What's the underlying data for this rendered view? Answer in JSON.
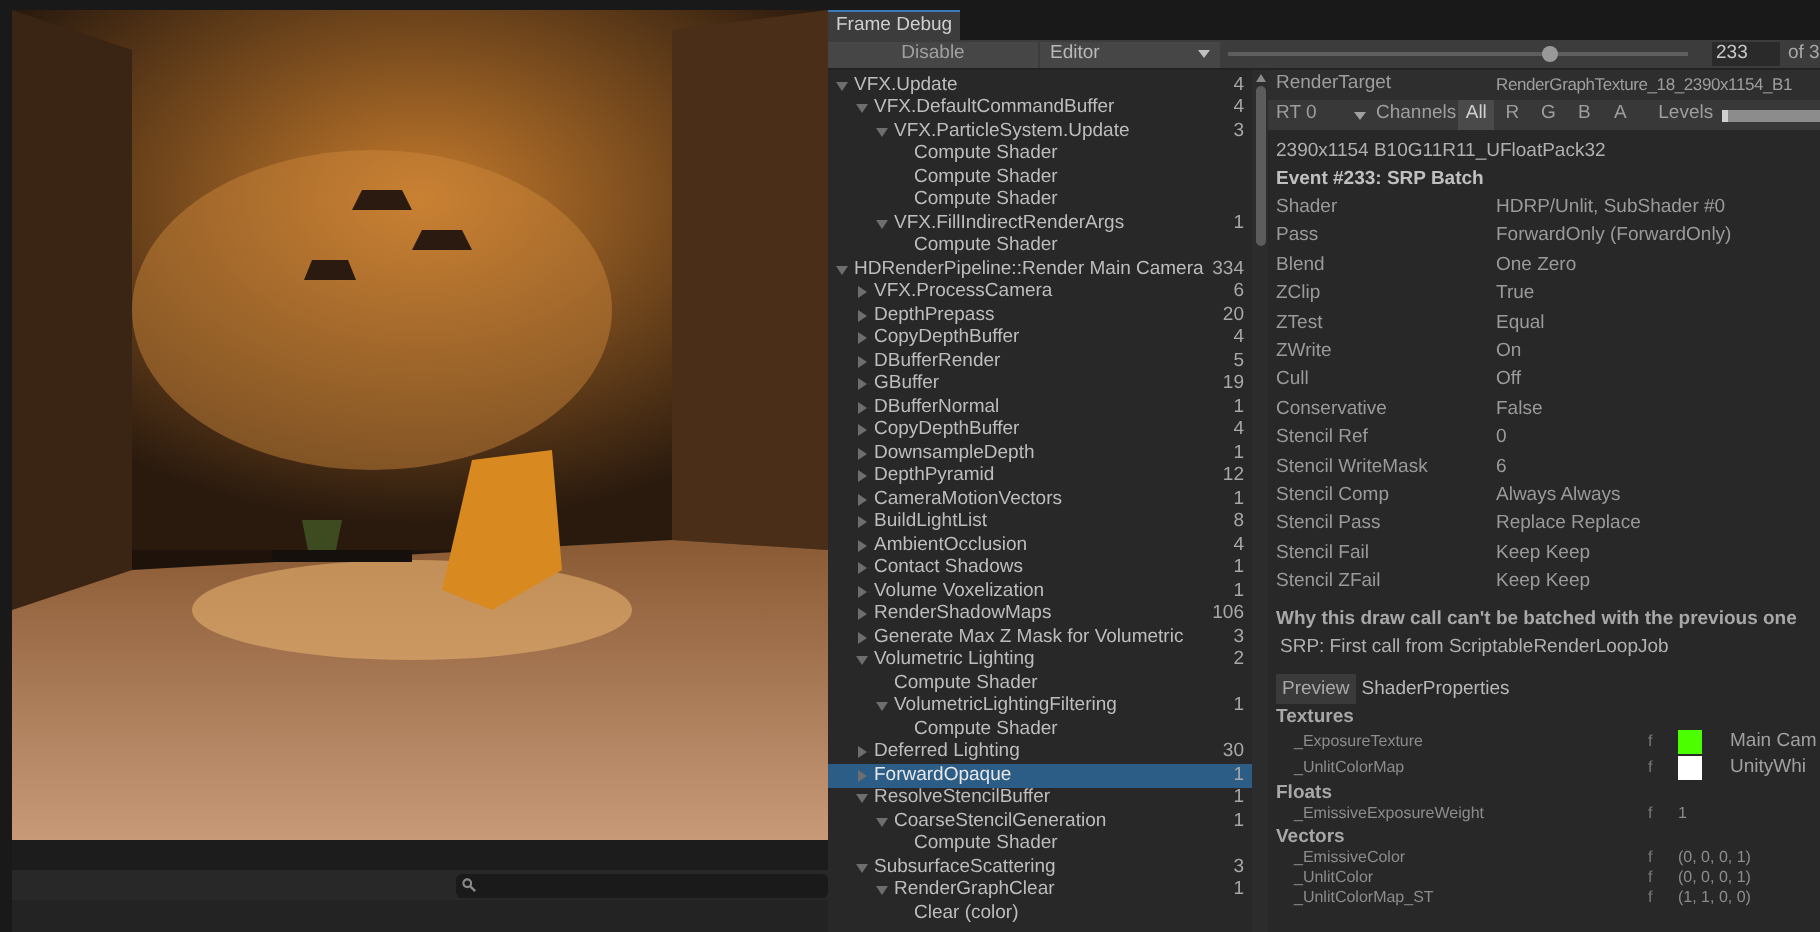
{
  "window_tab": {
    "title": "Frame Debug",
    "selected": true
  },
  "toolbar": {
    "disable_button": "Disable",
    "mode_dropdown": "Editor",
    "event_slider": {
      "level": 0.7
    },
    "event_number": "233",
    "event_total": "of 3"
  },
  "tree": [
    {
      "label": "VFX.Update",
      "count": "4",
      "expanded": true,
      "selected": false,
      "children": [
        {
          "label": "VFX.DefaultCommandBuffer",
          "count": "4",
          "expanded": true,
          "selected": false,
          "children": [
            {
              "label": "VFX.ParticleSystem.Update",
              "count": "3",
              "expanded": true,
              "selected": false,
              "children": [
                {
                  "label": "Compute Shader",
                  "selected": false
                },
                {
                  "label": "Compute Shader",
                  "selected": false
                },
                {
                  "label": "Compute Shader",
                  "selected": false
                }
              ]
            },
            {
              "label": "VFX.FillIndirectRenderArgs",
              "count": "1",
              "expanded": true,
              "selected": false,
              "children": [
                {
                  "label": "Compute Shader",
                  "selected": false
                }
              ]
            }
          ]
        }
      ]
    },
    {
      "label": "HDRenderPipeline::Render Main Camera",
      "count": "334",
      "expanded": true,
      "selected": false,
      "children": [
        {
          "label": "VFX.ProcessCamera",
          "count": "6",
          "expanded": false,
          "selected": false
        },
        {
          "label": "DepthPrepass",
          "count": "20",
          "expanded": false,
          "selected": false
        },
        {
          "label": "CopyDepthBuffer",
          "count": "4",
          "expanded": false,
          "selected": false
        },
        {
          "label": "DBufferRender",
          "count": "5",
          "expanded": false,
          "selected": false
        },
        {
          "label": "GBuffer",
          "count": "19",
          "expanded": false,
          "selected": false
        },
        {
          "label": "DBufferNormal",
          "count": "1",
          "expanded": false,
          "selected": false
        },
        {
          "label": "CopyDepthBuffer",
          "count": "4",
          "expanded": false,
          "selected": false
        },
        {
          "label": "DownsampleDepth",
          "count": "1",
          "expanded": false,
          "selected": false
        },
        {
          "label": "DepthPyramid",
          "count": "12",
          "expanded": false,
          "selected": false
        },
        {
          "label": "CameraMotionVectors",
          "count": "1",
          "expanded": false,
          "selected": false
        },
        {
          "label": "BuildLightList",
          "count": "8",
          "expanded": false,
          "selected": false
        },
        {
          "label": "AmbientOcclusion",
          "count": "4",
          "expanded": false,
          "selected": false
        },
        {
          "label": "Contact Shadows",
          "count": "1",
          "expanded": false,
          "selected": false
        },
        {
          "label": "Volume Voxelization",
          "count": "1",
          "expanded": false,
          "selected": false
        },
        {
          "label": "RenderShadowMaps",
          "count": "106",
          "expanded": false,
          "selected": false
        },
        {
          "label": "Generate Max Z Mask for Volumetric",
          "count": "3",
          "expanded": false,
          "selected": false
        },
        {
          "label": "Volumetric Lighting",
          "count": "2",
          "expanded": true,
          "selected": false,
          "children": [
            {
              "label": "Compute Shader",
              "selected": false
            },
            {
              "label": "VolumetricLightingFiltering",
              "count": "1",
              "expanded": true,
              "selected": false,
              "children": [
                {
                  "label": "Compute Shader",
                  "selected": false
                }
              ]
            }
          ]
        },
        {
          "label": "Deferred Lighting",
          "count": "30",
          "expanded": false,
          "selected": false
        },
        {
          "label": "ForwardOpaque",
          "count": "1",
          "expanded": false,
          "selected": true
        },
        {
          "label": "ResolveStencilBuffer",
          "count": "1",
          "expanded": true,
          "selected": false,
          "children": [
            {
              "label": "CoarseStencilGeneration",
              "count": "1",
              "expanded": true,
              "selected": false,
              "children": [
                {
                  "label": "Compute Shader",
                  "selected": false
                }
              ]
            }
          ]
        },
        {
          "label": "SubsurfaceScattering",
          "count": "3",
          "expanded": true,
          "selected": false,
          "children": [
            {
              "label": "RenderGraphClear",
              "count": "1",
              "expanded": true,
              "selected": false,
              "children": [
                {
                  "label": "Clear (color)",
                  "selected": false
                }
              ]
            }
          ]
        }
      ]
    }
  ],
  "details": {
    "render_target": {
      "label": "RenderTarget",
      "value": "RenderGraphTexture_18_2390x1154_B1"
    },
    "rt_dropdown": "RT 0",
    "channels_label": "Channels",
    "channels": [
      {
        "label": "All",
        "selected": true
      },
      {
        "label": "R",
        "selected": false
      },
      {
        "label": "G",
        "selected": false
      },
      {
        "label": "B",
        "selected": false
      },
      {
        "label": "A",
        "selected": false
      }
    ],
    "levels_label": "Levels",
    "levels_slider": {
      "level": 0
    },
    "format": "2390x1154 B10G11R11_UFloatPack32",
    "event_title": "Event #233: SRP Batch",
    "properties": [
      {
        "label": "Shader",
        "value": "HDRP/Unlit, SubShader #0"
      },
      {
        "label": "Pass",
        "value": "ForwardOnly (ForwardOnly)"
      },
      {
        "label": "Blend",
        "value": "One Zero"
      },
      {
        "label": "ZClip",
        "value": "True"
      },
      {
        "label": "ZTest",
        "value": "Equal"
      },
      {
        "label": "ZWrite",
        "value": "On"
      },
      {
        "label": "Cull",
        "value": "Off"
      },
      {
        "label": "Conservative",
        "value": "False"
      },
      {
        "label": "Stencil Ref",
        "value": "0"
      },
      {
        "label": "Stencil WriteMask",
        "value": "6"
      },
      {
        "label": "Stencil Comp",
        "value": "Always Always"
      },
      {
        "label": "Stencil Pass",
        "value": "Replace Replace"
      },
      {
        "label": "Stencil Fail",
        "value": "Keep Keep"
      },
      {
        "label": "Stencil ZFail",
        "value": "Keep Keep"
      }
    ],
    "batch_heading": "Why this draw call can't be batched with the previous one",
    "batch_reason": "SRP: First call from ScriptableRenderLoopJob",
    "tabs": [
      {
        "label": "Preview",
        "selected": true
      },
      {
        "label": "ShaderProperties",
        "selected": false
      }
    ],
    "sections": [
      {
        "title": "Textures",
        "items": [
          {
            "kind": "texture",
            "name": "_ExposureTexture",
            "type": "f",
            "color": "#4cff00",
            "value": "Main Cam"
          },
          {
            "kind": "texture",
            "name": "_UnlitColorMap",
            "type": "f",
            "color": "#ffffff",
            "value": "UnityWhi"
          }
        ]
      },
      {
        "title": "Floats",
        "items": [
          {
            "kind": "value",
            "name": "_EmissiveExposureWeight",
            "type": "f",
            "value": "1"
          }
        ]
      },
      {
        "title": "Vectors",
        "items": [
          {
            "kind": "value",
            "name": "_EmissiveColor",
            "type": "f",
            "value": "(0, 0, 0, 1)"
          },
          {
            "kind": "value",
            "name": "_UnlitColor",
            "type": "f",
            "value": "(0, 0, 0, 1)"
          },
          {
            "kind": "value",
            "name": "_UnlitColorMap_ST",
            "type": "f",
            "value": "(1, 1, 0, 0)"
          }
        ]
      }
    ]
  }
}
